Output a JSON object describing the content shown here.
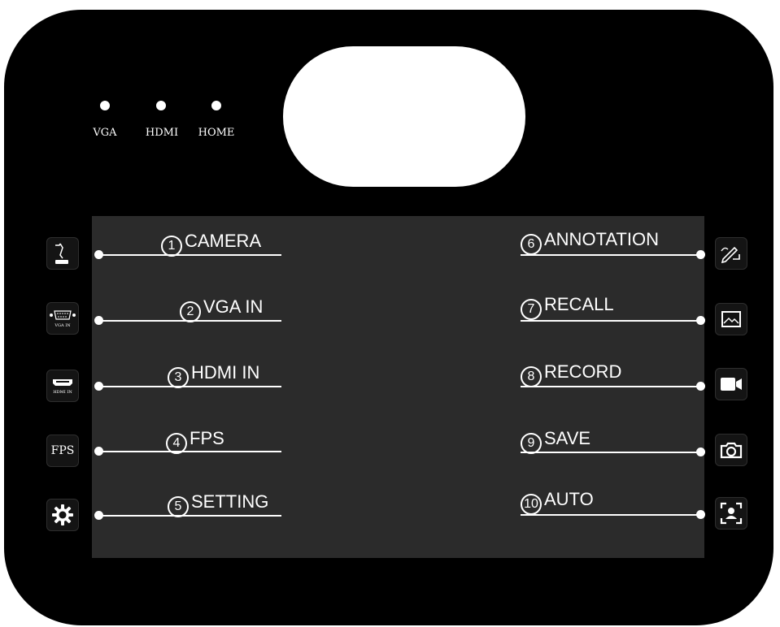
{
  "indicators": [
    {
      "label": "VGA"
    },
    {
      "label": "HDMI"
    },
    {
      "label": "HOME"
    }
  ],
  "left_items": [
    {
      "num": "1",
      "label": "CAMERA",
      "icon": "camera-arm-icon"
    },
    {
      "num": "2",
      "label": "VGA IN",
      "icon": "vga-port-icon",
      "icon_caption": "VGA IN"
    },
    {
      "num": "3",
      "label": "HDMI IN",
      "icon": "hdmi-port-icon",
      "icon_caption": "HDMI IN"
    },
    {
      "num": "4",
      "label": "FPS",
      "icon": "fps-icon",
      "icon_text": "FPS"
    },
    {
      "num": "5",
      "label": "SETTING",
      "icon": "gear-icon"
    }
  ],
  "right_items": [
    {
      "num": "6",
      "label": "ANNOTATION",
      "icon": "pen-icon"
    },
    {
      "num": "7",
      "label": "RECALL",
      "icon": "image-icon"
    },
    {
      "num": "8",
      "label": "RECORD",
      "icon": "video-camera-icon"
    },
    {
      "num": "9",
      "label": "SAVE",
      "icon": "photo-camera-icon"
    },
    {
      "num": "10",
      "label": "AUTO",
      "icon": "auto-focus-icon"
    }
  ],
  "colors": {
    "panel": "#000000",
    "screen": "#2b2b2b",
    "foreground": "#ffffff"
  }
}
